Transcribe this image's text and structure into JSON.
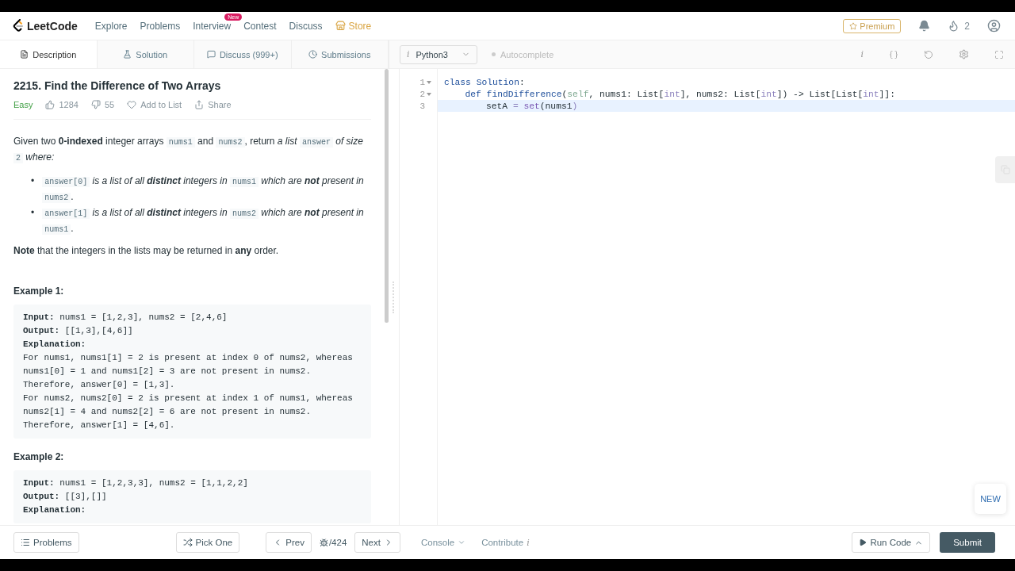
{
  "nav": {
    "logo": "LeetCode",
    "items": [
      {
        "label": "Explore",
        "kind": "link"
      },
      {
        "label": "Problems",
        "kind": "link"
      },
      {
        "label": "Interview",
        "kind": "link",
        "badge": "New"
      },
      {
        "label": "Contest",
        "kind": "link"
      },
      {
        "label": "Discuss",
        "kind": "link"
      },
      {
        "label": "Store",
        "kind": "store"
      }
    ],
    "premium": "Premium",
    "streak": "2"
  },
  "tabs": [
    {
      "label": "Description",
      "selected": true
    },
    {
      "label": "Solution",
      "selected": false
    },
    {
      "label": "Discuss (999+)",
      "selected": false
    },
    {
      "label": "Submissions",
      "selected": false
    }
  ],
  "editor_toolbar": {
    "language_info": "i",
    "language": "Python3",
    "autocomplete": "Autocomplete",
    "autocomplete_on": false,
    "info": "i"
  },
  "problem": {
    "title": "2215. Find the Difference of Two Arrays",
    "difficulty": "Easy",
    "likes": "1284",
    "dislikes": "55",
    "add_to_list": "Add to List",
    "share": "Share",
    "intro": [
      {
        "kind": "plain",
        "text": "Given two "
      },
      {
        "kind": "bold",
        "text": "0-indexed"
      },
      {
        "kind": "plain",
        "text": " integer arrays "
      },
      {
        "kind": "code",
        "text": "nums1"
      },
      {
        "kind": "plain",
        "text": " and "
      },
      {
        "kind": "code",
        "text": "nums2"
      },
      {
        "kind": "plain",
        "text": ", return "
      },
      {
        "kind": "italic",
        "text": "a list "
      },
      {
        "kind": "code",
        "text": "answer"
      },
      {
        "kind": "italic",
        "text": " of size "
      },
      {
        "kind": "code",
        "text": "2"
      },
      {
        "kind": "italic",
        "text": " where:"
      }
    ],
    "bullets": [
      {
        "marker": "•",
        "segments": [
          {
            "kind": "code",
            "text": "answer[0]"
          },
          {
            "kind": "italic",
            "text": " is a list of all "
          },
          {
            "kind": "bold_italic",
            "text": "distinct"
          },
          {
            "kind": "italic",
            "text": " integers in "
          },
          {
            "kind": "code",
            "text": "nums1"
          },
          {
            "kind": "italic",
            "text": " which are "
          },
          {
            "kind": "bold_italic",
            "text": "not"
          },
          {
            "kind": "italic",
            "text": " present in "
          },
          {
            "kind": "code",
            "text": "nums2"
          },
          {
            "kind": "plain",
            "text": "."
          }
        ]
      },
      {
        "marker": "•",
        "segments": [
          {
            "kind": "code",
            "text": "answer[1]"
          },
          {
            "kind": "italic",
            "text": " is a list of all "
          },
          {
            "kind": "bold_italic",
            "text": "distinct"
          },
          {
            "kind": "italic",
            "text": " integers in "
          },
          {
            "kind": "code",
            "text": "nums2"
          },
          {
            "kind": "italic",
            "text": " which are "
          },
          {
            "kind": "bold_italic",
            "text": "not"
          },
          {
            "kind": "italic",
            "text": " present in "
          },
          {
            "kind": "code",
            "text": "nums1"
          },
          {
            "kind": "plain",
            "text": "."
          }
        ]
      }
    ],
    "note": [
      {
        "kind": "bold",
        "text": "Note"
      },
      {
        "kind": "plain",
        "text": " that the integers in the lists may be returned in "
      },
      {
        "kind": "bold",
        "text": "any"
      },
      {
        "kind": "plain",
        "text": " order."
      }
    ],
    "examples": [
      {
        "title": "Example 1:",
        "lines": [
          {
            "label": "Input:",
            "text": " nums1 = [1,2,3], nums2 = [2,4,6]"
          },
          {
            "label": "Output:",
            "text": " [[1,3],[4,6]]"
          },
          {
            "label": "Explanation:"
          },
          {
            "text": "For nums1, nums1[1] = 2 is present at index 0 of nums2, whereas"
          },
          {
            "text": "nums1[0] = 1 and nums1[2] = 3 are not present in nums2."
          },
          {
            "text": "Therefore, answer[0] = [1,3]."
          },
          {
            "text": "For nums2, nums2[0] = 2 is present at index 1 of nums1, whereas"
          },
          {
            "text": "nums2[1] = 4 and nums2[2] = 6 are not present in nums2."
          },
          {
            "text": "Therefore, answer[1] = [4,6]."
          }
        ]
      },
      {
        "title": "Example 2:",
        "lines": [
          {
            "label": "Input:",
            "text": " nums1 = [1,2,3,3], nums2 = [1,1,2,2]"
          },
          {
            "label": "Output:",
            "text": " [[3],[]]"
          },
          {
            "label": "Explanation:"
          }
        ]
      }
    ]
  },
  "code": [
    {
      "number": "1",
      "fold": true,
      "active": false,
      "tokens": [
        {
          "kind": "keyword",
          "text": "class"
        },
        {
          "kind": "keyword",
          "text": " Solution"
        },
        {
          "kind": "plain",
          "text": ":"
        }
      ],
      "children": [
        {
          "number": "2",
          "fold": true,
          "active": false,
          "tokens": [
            {
              "kind": "keyword",
              "text": "def"
            },
            {
              "kind": "keyword",
              "text": " findDifference"
            },
            {
              "kind": "plain",
              "text": "("
            },
            {
              "kind": "self",
              "text": "self"
            },
            {
              "kind": "plain",
              "text": ", nums1: List["
            },
            {
              "kind": "type",
              "text": "int"
            },
            {
              "kind": "plain",
              "text": "], nums2: List["
            },
            {
              "kind": "type",
              "text": "int"
            },
            {
              "kind": "plain",
              "text": "]) -> List[List["
            },
            {
              "kind": "type",
              "text": "int"
            },
            {
              "kind": "plain",
              "text": "]]:"
            }
          ],
          "children": [
            {
              "number": "3",
              "fold": false,
              "active": true,
              "tokens": [
                {
                  "kind": "plain",
                  "text": "setA "
                },
                {
                  "kind": "op",
                  "text": "="
                },
                {
                  "kind": "builtin",
                  "text": " set"
                },
                {
                  "kind": "plain",
                  "text": "(nums1"
                },
                {
                  "kind": "op",
                  "text": ")"
                }
              ]
            }
          ]
        }
      ]
    }
  ],
  "new_button": "NEW",
  "bottom": {
    "problems": "Problems",
    "pick_one": "Pick One",
    "prev": "Prev",
    "counter": "/424",
    "next": "Next",
    "console": "Console",
    "contribute": "Contribute",
    "contribute_info": "i",
    "run": "Run Code",
    "submit": "Submit"
  }
}
